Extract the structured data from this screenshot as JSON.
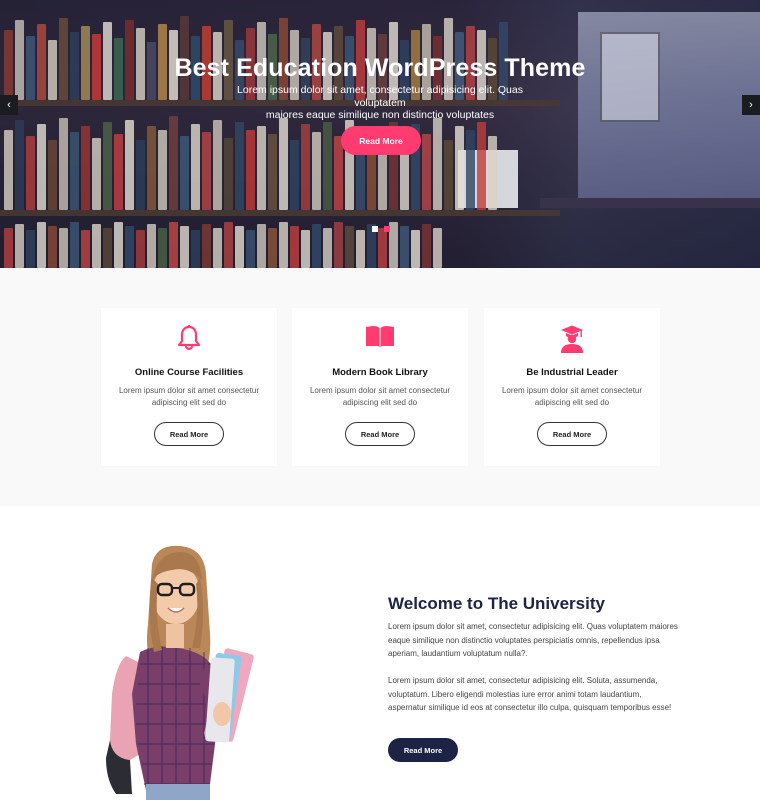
{
  "hero": {
    "title": "Best Education WordPress Theme",
    "subtitle_line1": "Lorem ipsum dolor sit amet, consectetur adipisicing elit. Quas voluptatem",
    "subtitle_line2": "maiores eaque similique non distinctio voluptates",
    "button_label": "Read More",
    "prev_arrow": "‹",
    "next_arrow": "›",
    "slide_count": 2,
    "active_slide": 2
  },
  "features": {
    "cards": [
      {
        "icon": "bell-icon",
        "title": "Online Course Facilities",
        "description": "Lorem ipsum dolor sit amet consectetur adipiscing elit sed do",
        "button_label": "Read More"
      },
      {
        "icon": "book-icon",
        "title": "Modern Book Library",
        "description": "Lorem ipsum dolor sit amet consectetur adipiscing elit sed do",
        "button_label": "Read More"
      },
      {
        "icon": "graduate-icon",
        "title": "Be Industrial Leader",
        "description": "Lorem ipsum dolor sit amet consectetur adipiscing elit sed do",
        "button_label": "Read More"
      }
    ]
  },
  "welcome": {
    "title": "Welcome to The University",
    "paragraph1": "Lorem ipsum dolor sit amet, consectetur adipisicing elit. Quas voluptatem maiores eaque similique non distinctio voluptates perspiciatis omnis, repellendus ipsa aperiam, laudantium voluptatum nulla?.",
    "paragraph2": "Lorem ipsum dolor sit amet, consectetur adipisicing elit. Soluta, assumenda, voluptatum. Libero eligendi molestias iure error animi totam laudantium, aspernatur similique id eos at consectetur illo culpa, quisquam temporibus esse!",
    "button_label": "Read More"
  },
  "colors": {
    "accent": "#ff3b6f",
    "navy": "#1c2344",
    "section_bg": "#f9f9fa"
  }
}
